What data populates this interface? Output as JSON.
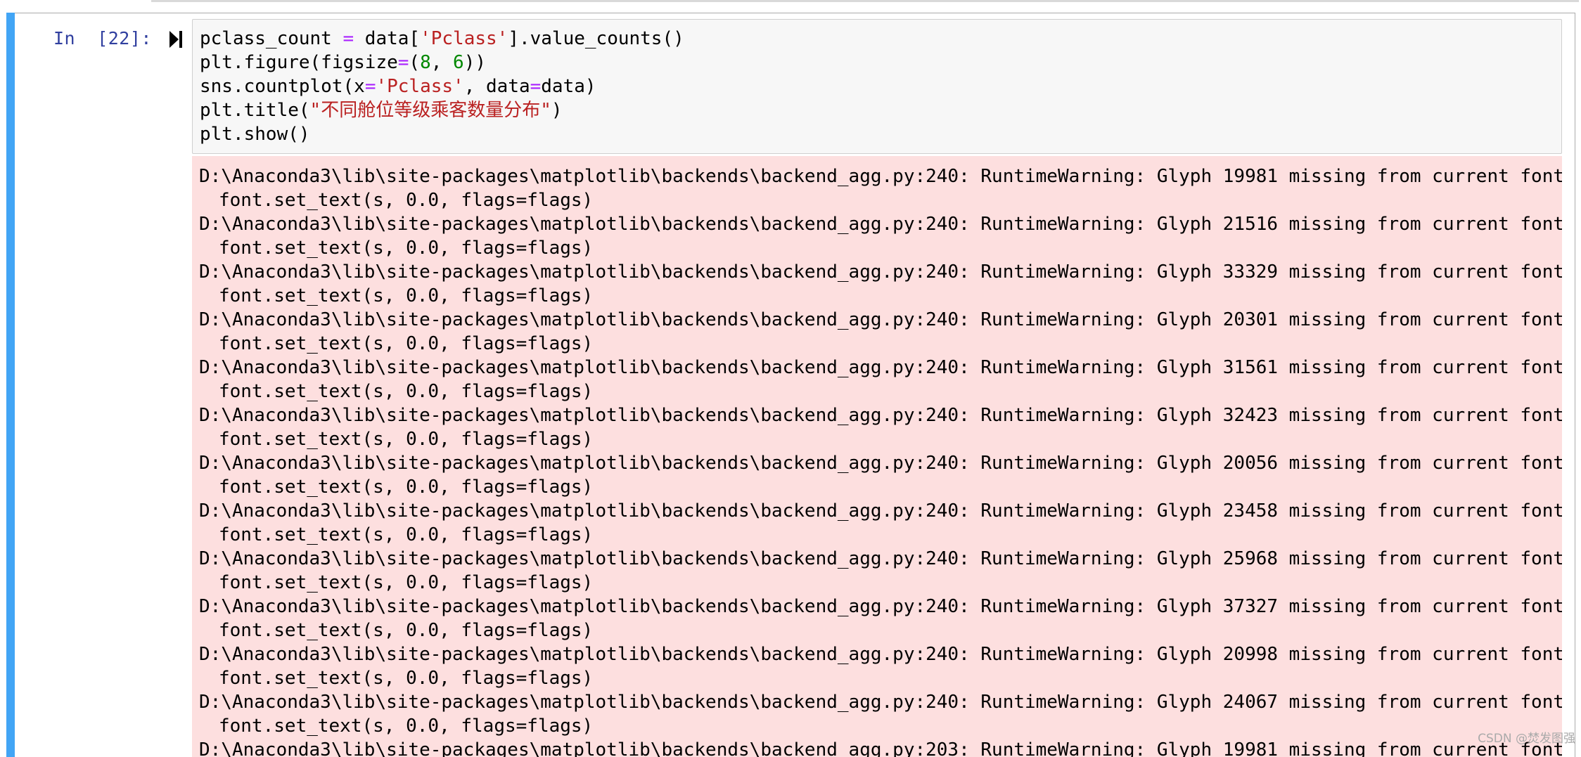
{
  "cell": {
    "prompt": "In  [22]:",
    "run_icon": "run-cell-icon",
    "accent_color": "#42a5f5",
    "code": {
      "line1": {
        "a": "pclass_count ",
        "op": "=",
        "b": " data[",
        "s": "'Pclass'",
        "c": "].value_counts()"
      },
      "line2": {
        "a": "plt.figure(figsize",
        "op": "=",
        "b": "(",
        "n1": "8",
        "c": ", ",
        "n2": "6",
        "d": "))"
      },
      "line3": {
        "a": "sns.countplot(x",
        "op1": "=",
        "s": "'Pclass'",
        "b": ", data",
        "op2": "=",
        "c": "data)"
      },
      "line4": {
        "a": "plt.title(",
        "s": "\"不同舱位等级乘客数量分布\"",
        "b": ")"
      },
      "line5": {
        "a": "plt.show()"
      }
    }
  },
  "output": {
    "background": "#fddfdf",
    "warnings": [
      {
        "path": "D:\\Anaconda3\\lib\\site-packages\\matplotlib\\backends\\backend_agg.py:240: RuntimeWarning: Glyph 19981 missing from current font.",
        "detail": "font.set_text(s, 0.0, flags=flags)"
      },
      {
        "path": "D:\\Anaconda3\\lib\\site-packages\\matplotlib\\backends\\backend_agg.py:240: RuntimeWarning: Glyph 21516 missing from current font.",
        "detail": "font.set_text(s, 0.0, flags=flags)"
      },
      {
        "path": "D:\\Anaconda3\\lib\\site-packages\\matplotlib\\backends\\backend_agg.py:240: RuntimeWarning: Glyph 33329 missing from current font.",
        "detail": "font.set_text(s, 0.0, flags=flags)"
      },
      {
        "path": "D:\\Anaconda3\\lib\\site-packages\\matplotlib\\backends\\backend_agg.py:240: RuntimeWarning: Glyph 20301 missing from current font.",
        "detail": "font.set_text(s, 0.0, flags=flags)"
      },
      {
        "path": "D:\\Anaconda3\\lib\\site-packages\\matplotlib\\backends\\backend_agg.py:240: RuntimeWarning: Glyph 31561 missing from current font.",
        "detail": "font.set_text(s, 0.0, flags=flags)"
      },
      {
        "path": "D:\\Anaconda3\\lib\\site-packages\\matplotlib\\backends\\backend_agg.py:240: RuntimeWarning: Glyph 32423 missing from current font.",
        "detail": "font.set_text(s, 0.0, flags=flags)"
      },
      {
        "path": "D:\\Anaconda3\\lib\\site-packages\\matplotlib\\backends\\backend_agg.py:240: RuntimeWarning: Glyph 20056 missing from current font.",
        "detail": "font.set_text(s, 0.0, flags=flags)"
      },
      {
        "path": "D:\\Anaconda3\\lib\\site-packages\\matplotlib\\backends\\backend_agg.py:240: RuntimeWarning: Glyph 23458 missing from current font.",
        "detail": "font.set_text(s, 0.0, flags=flags)"
      },
      {
        "path": "D:\\Anaconda3\\lib\\site-packages\\matplotlib\\backends\\backend_agg.py:240: RuntimeWarning: Glyph 25968 missing from current font.",
        "detail": "font.set_text(s, 0.0, flags=flags)"
      },
      {
        "path": "D:\\Anaconda3\\lib\\site-packages\\matplotlib\\backends\\backend_agg.py:240: RuntimeWarning: Glyph 37327 missing from current font.",
        "detail": "font.set_text(s, 0.0, flags=flags)"
      },
      {
        "path": "D:\\Anaconda3\\lib\\site-packages\\matplotlib\\backends\\backend_agg.py:240: RuntimeWarning: Glyph 20998 missing from current font.",
        "detail": "font.set_text(s, 0.0, flags=flags)"
      },
      {
        "path": "D:\\Anaconda3\\lib\\site-packages\\matplotlib\\backends\\backend_agg.py:240: RuntimeWarning: Glyph 24067 missing from current font.",
        "detail": "font.set_text(s, 0.0, flags=flags)"
      },
      {
        "path": "D:\\Anaconda3\\lib\\site-packages\\matplotlib\\backends\\backend_agg.py:203: RuntimeWarning: Glyph 19981 missing from current font.",
        "detail": ""
      }
    ]
  },
  "watermark": "CSDN @焚发图强"
}
